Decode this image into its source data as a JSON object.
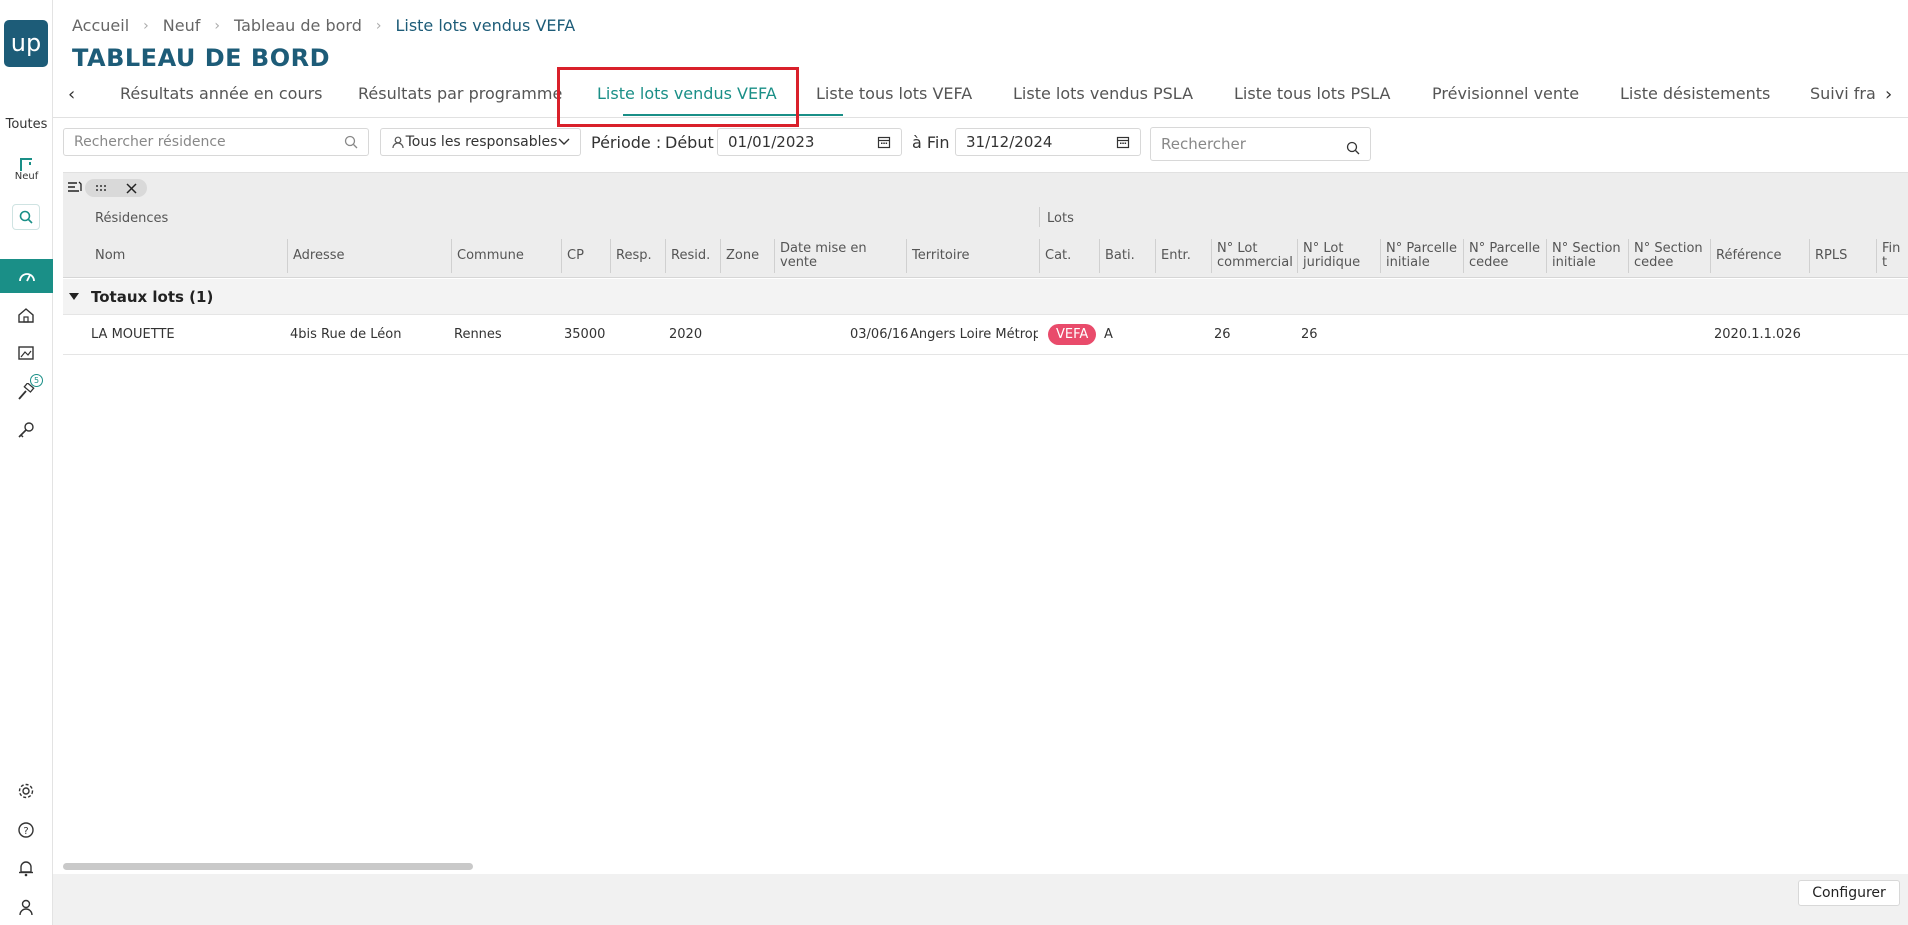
{
  "app": {
    "logo": "up"
  },
  "sidebar": {
    "filter_all": "Toutes",
    "neuf_label": "Neuf",
    "notification_badge": "5",
    "icons": [
      "building-icon",
      "search-icon",
      "dashboard-icon",
      "house-icon",
      "gallery-icon",
      "hammer-icon",
      "key-icon",
      "gear-icon",
      "help-icon",
      "bell-icon",
      "user-icon"
    ]
  },
  "breadcrumb": {
    "items": [
      "Accueil",
      "Neuf",
      "Tableau de bord"
    ],
    "current": "Liste lots vendus VEFA"
  },
  "page_title": "TABLEAU DE BORD",
  "tabs": [
    "Résultats année en cours",
    "Résultats par programme",
    "Liste lots vendus VEFA",
    "Liste tous lots VEFA",
    "Liste lots vendus PSLA",
    "Liste tous lots PSLA",
    "Prévisionnel vente",
    "Liste désistements",
    "Suivi fra"
  ],
  "active_tab": "Liste lots vendus VEFA",
  "filters": {
    "residence_placeholder": "Rechercher résidence",
    "responsables": "Tous les responsables",
    "periode_label": "Période :",
    "debut_label": "Début",
    "debut_value": "01/01/2023",
    "fin_label": "à Fin",
    "fin_value": "31/12/2024",
    "search_placeholder": "Rechercher"
  },
  "grid": {
    "groups": {
      "residences": "Résidences",
      "lots": "Lots"
    },
    "columns": [
      "Nom",
      "Adresse",
      "Commune",
      "CP",
      "Resp.",
      "Resid.",
      "Zone",
      "Date mise en vente",
      "Territoire",
      "Cat.",
      "Bati.",
      "Entr.",
      "N° Lot commercial",
      "N° Lot juridique",
      "N° Parcelle initiale",
      "N° Parcelle cedee",
      "N° Section initiale",
      "N° Section cedee",
      "Référence",
      "RPLS",
      "Fin t"
    ],
    "totals_label": "Totaux lots (1)",
    "rows": [
      {
        "nom": "LA MOUETTE",
        "adresse": "4bis Rue de Léon",
        "commune": "Rennes",
        "cp": "35000",
        "resid": "2020",
        "date_mise_en_vente": "03/06/16",
        "territoire": "Angers Loire Métrop",
        "cat": "VEFA",
        "bati": "A",
        "lot_commercial": "26",
        "lot_juridique": "26",
        "reference": "2020.1.1.026"
      }
    ]
  },
  "footer": {
    "configure_label": "Configurer"
  },
  "colors": {
    "brand": "#1d5c78",
    "accent": "#1a8f87",
    "badge": "#e94b6b",
    "highlight": "#d9202a"
  }
}
